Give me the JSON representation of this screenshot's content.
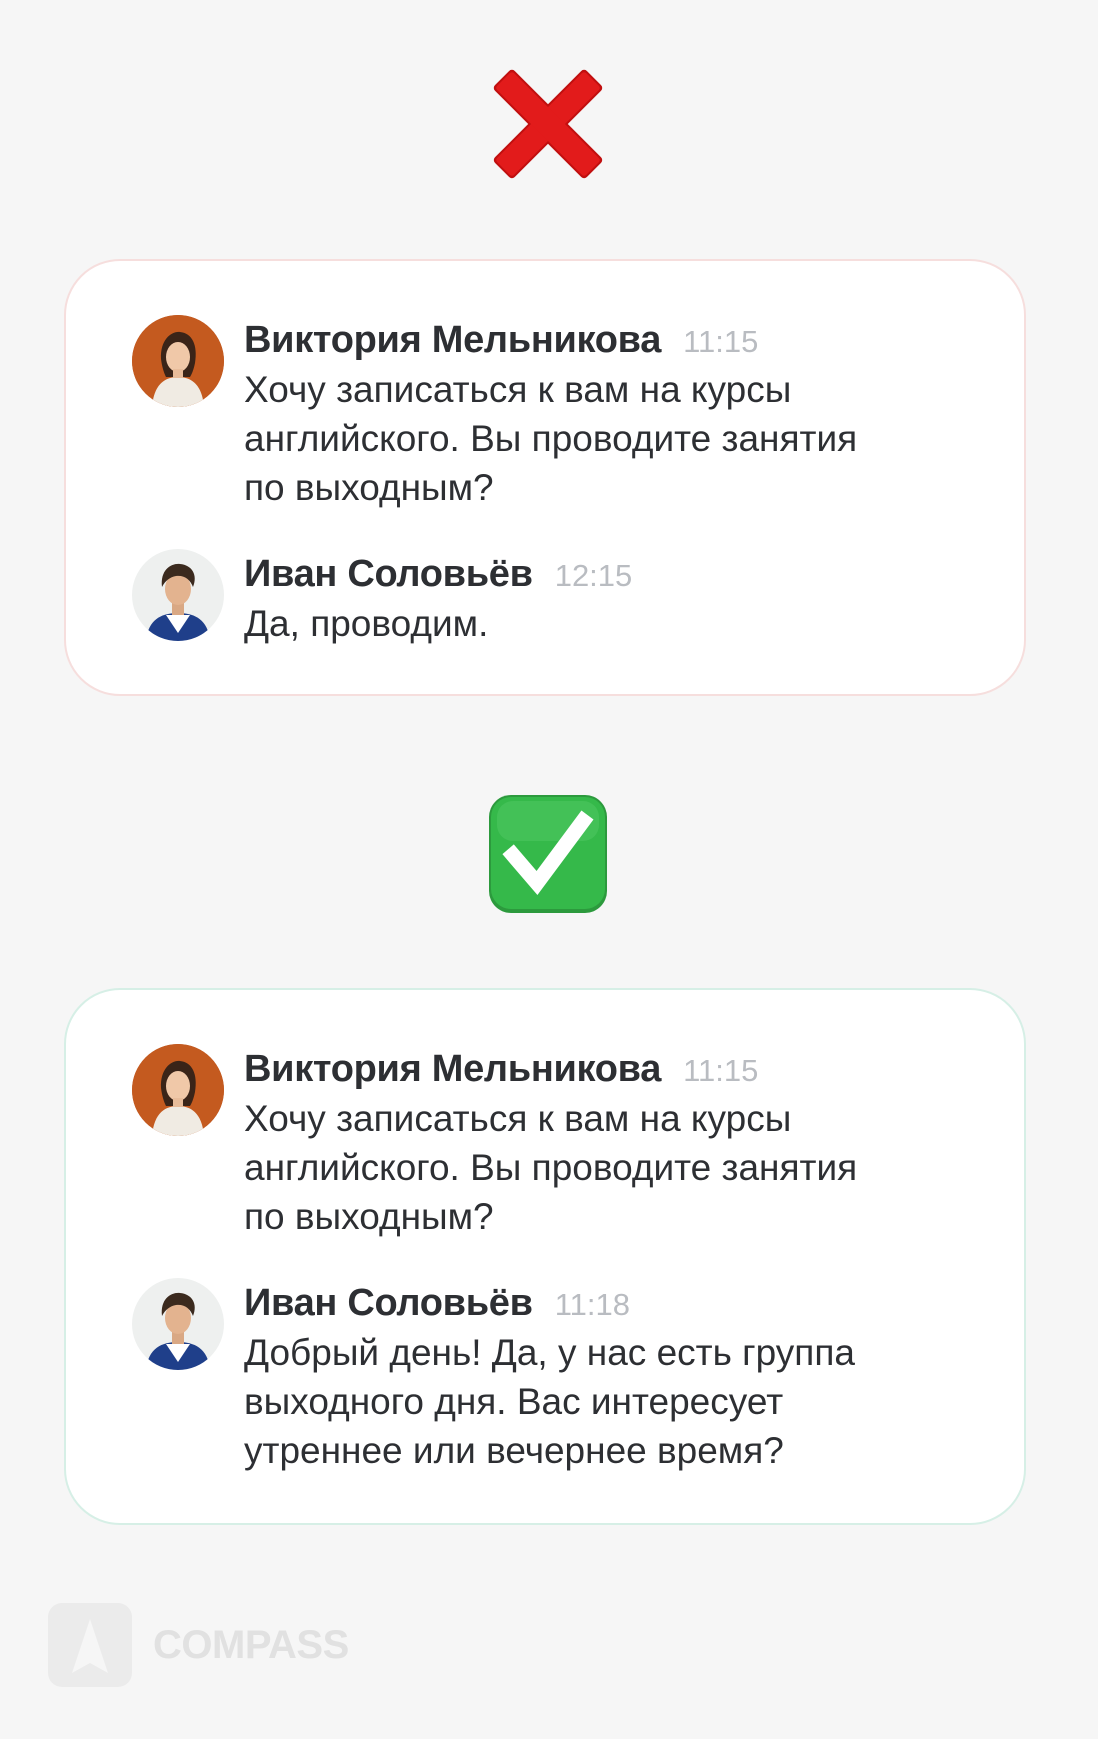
{
  "wrong_example": {
    "icon": "red-cross-mark-icon",
    "messages": [
      {
        "author": "Виктория Мельникова",
        "time": "11:15",
        "lines": [
          "Хочу записаться к вам на курсы",
          "английского. Вы проводите занятия",
          "по выходным?"
        ],
        "avatar": "woman-avatar"
      },
      {
        "author": "Иван Соловьёв",
        "time": "12:15",
        "lines": [
          "Да, проводим."
        ],
        "avatar": "man-avatar"
      }
    ]
  },
  "right_example": {
    "icon": "green-check-mark-icon",
    "messages": [
      {
        "author": "Виктория Мельникова",
        "time": "11:15",
        "lines": [
          "Хочу записаться к вам на курсы",
          "английского. Вы проводите занятия",
          "по выходным?"
        ],
        "avatar": "woman-avatar"
      },
      {
        "author": "Иван Соловьёв",
        "time": "11:18",
        "lines": [
          "Добрый день! Да, у нас есть группа",
          "выходного дня. Вас интересует",
          "утреннее или вечернее время?"
        ],
        "avatar": "man-avatar"
      }
    ]
  },
  "brand": {
    "name": "COMPASS",
    "icon": "compass-logo-icon"
  },
  "colors": {
    "background": "#f6f6f6",
    "wrong_accent": "#e21b1b",
    "right_accent": "#35b94a",
    "wrong_card_border": "#f6dedd",
    "right_card_border": "#d6efe6",
    "text": "#2d2f33",
    "time": "#b9bcc1"
  }
}
